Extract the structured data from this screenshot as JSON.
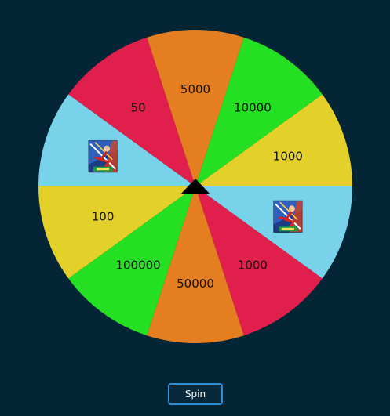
{
  "wheel": {
    "segments": [
      {
        "label": "",
        "color": "#78d3ea",
        "icon": "game-character-icon"
      },
      {
        "label": "1000",
        "color": "#e01f4c"
      },
      {
        "label": "50000",
        "color": "#e47e20"
      },
      {
        "label": "100000",
        "color": "#25e022"
      },
      {
        "label": "100",
        "color": "#e3d12a"
      },
      {
        "label": "",
        "color": "#78d3ea",
        "icon": "game-character-icon"
      },
      {
        "label": "50",
        "color": "#e01f4c"
      },
      {
        "label": "5000",
        "color": "#e47e20"
      },
      {
        "label": "10000",
        "color": "#25e022"
      },
      {
        "label": "1000",
        "color": "#e3d12a"
      }
    ],
    "pointer_icon": "triangle-pointer-icon"
  },
  "controls": {
    "spin_label": "Spin"
  },
  "colors": {
    "background": "#032536",
    "button_border": "#2a8fd6"
  }
}
